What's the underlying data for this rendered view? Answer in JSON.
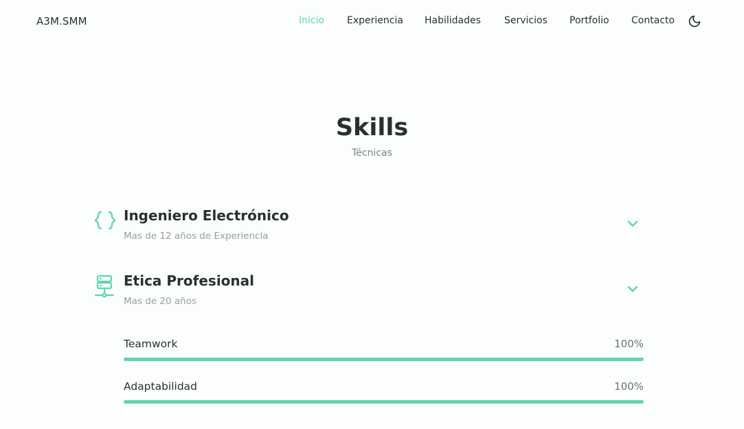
{
  "header": {
    "logo": "A3M.SMM",
    "nav": [
      {
        "label": "Inicio",
        "active": true
      },
      {
        "label": "Experiencia",
        "active": false
      },
      {
        "label": "Habilidades",
        "active": false
      },
      {
        "label": "Servicios",
        "active": false
      },
      {
        "label": "Portfolio",
        "active": false
      },
      {
        "label": "Contacto",
        "active": false
      }
    ],
    "theme_icon": "moon-icon"
  },
  "section": {
    "title": "Skills",
    "subtitle": "Técnicas"
  },
  "skill_groups": [
    {
      "icon": "code-braces-icon",
      "name": "Ingeniero Electrónico",
      "sub": "Mas de 12 años de Experiencia",
      "expanded": false
    },
    {
      "icon": "server-network-icon",
      "name": "Etica Profesional",
      "sub": "Mas de 20 años",
      "expanded": true
    }
  ],
  "skills": [
    {
      "label": "Teamwork",
      "value_text": "100%",
      "percent": 100
    },
    {
      "label": "Adaptabilidad",
      "value_text": "100%",
      "percent": 100
    }
  ],
  "colors": {
    "accent": "#5fd6ae",
    "text": "#2b2f30",
    "muted": "#9a9d9e",
    "background": "#fbfefd"
  }
}
